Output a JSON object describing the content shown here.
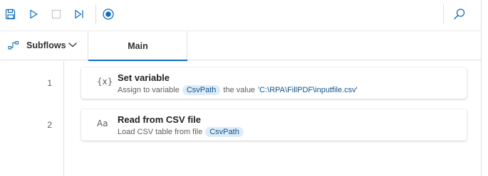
{
  "toolbar": {
    "buttons": [
      {
        "name": "save-icon"
      },
      {
        "name": "run-icon"
      },
      {
        "name": "stop-icon"
      },
      {
        "name": "run-next-action-icon"
      },
      {
        "name": "record-icon"
      },
      {
        "name": "search-icon"
      }
    ],
    "accent_color": "#0f6cbd"
  },
  "tabs": {
    "subflows_label": "Subflows",
    "main_label": "Main"
  },
  "actions": [
    {
      "line": "1",
      "icon": "{x}",
      "title": "Set variable",
      "prefix": "Assign to variable",
      "variable": "CsvPath",
      "middle": "the value",
      "value": "'C:\\RPA\\FillPDF\\inputfile.csv'"
    },
    {
      "line": "2",
      "icon": "Aa",
      "title": "Read from CSV file",
      "prefix": "Load CSV table from file",
      "variable": "CsvPath"
    }
  ]
}
